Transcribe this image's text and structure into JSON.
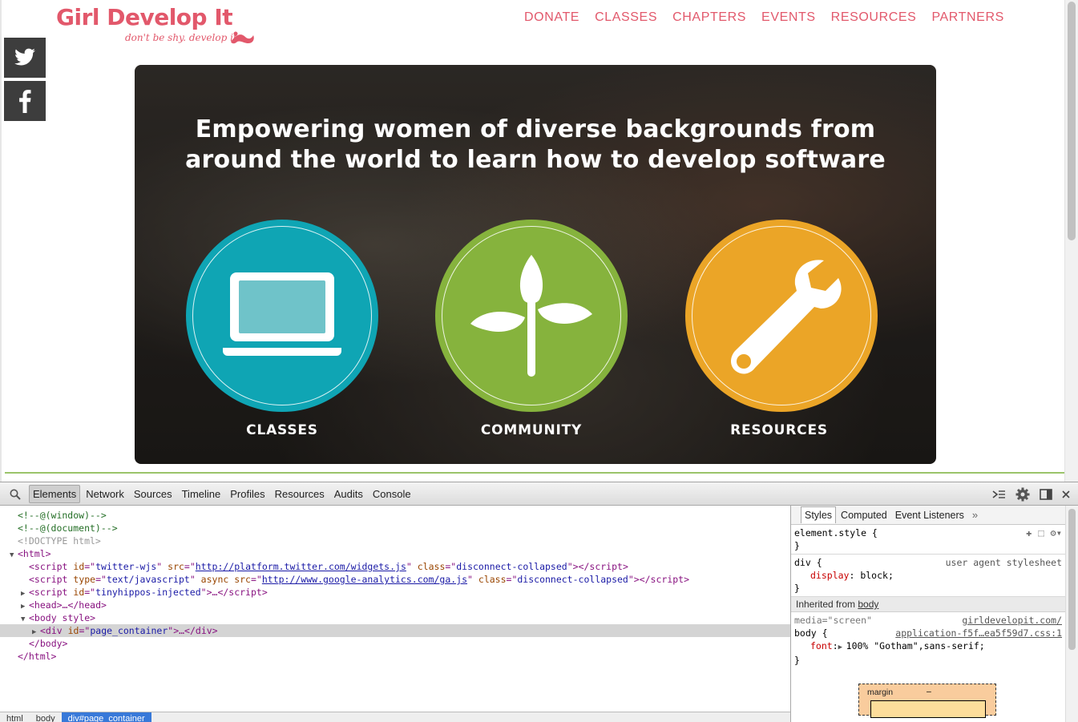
{
  "site": {
    "logo_title": "Girl Develop It",
    "logo_tagline": "don't be shy. develop it.",
    "nav": [
      "DONATE",
      "CLASSES",
      "CHAPTERS",
      "EVENTS",
      "RESOURCES",
      "PARTNERS"
    ],
    "social": [
      "twitter-icon",
      "facebook-icon"
    ],
    "hero_title_line1": "Empowering women of diverse backgrounds from",
    "hero_title_line2": "around the world to learn how to develop software",
    "circles": [
      {
        "label": "CLASSES",
        "color": "#0fa5b4",
        "icon": "laptop-icon"
      },
      {
        "label": "COMMUNITY",
        "color": "#86b33d",
        "icon": "sprout-icon"
      },
      {
        "label": "RESOURCES",
        "color": "#eba527",
        "icon": "wrench-icon"
      }
    ],
    "accent_color": "#e2586b"
  },
  "devtools": {
    "tabs": [
      "Elements",
      "Network",
      "Sources",
      "Timeline",
      "Profiles",
      "Resources",
      "Audits",
      "Console"
    ],
    "active_tab": "Elements",
    "dom": {
      "l1": "<!--@(window)-->",
      "l2": "<!--@(document)-->",
      "l3": "<!DOCTYPE html>",
      "html_open": "<html>",
      "s1_id": "twitter-wjs",
      "s1_src": "http://platform.twitter.com/widgets.js",
      "s1_class": "disconnect-collapsed",
      "s2_type": "text/javascript",
      "s2_src": "http://www.google-analytics.com/ga.js",
      "s2_class": "disconnect-collapsed",
      "s3_id": "tinyhippos-injected",
      "head": "<head>…</head>",
      "body_open": "<body style>",
      "div_id": "page_container",
      "body_close": "</body>",
      "html_close": "</html>"
    },
    "breadcrumbs": [
      "html",
      "body",
      "div#page_container"
    ],
    "styles": {
      "tabs": [
        "Styles",
        "Computed",
        "Event Listeners"
      ],
      "element_style": "element.style {",
      "rule2_selector": "div {",
      "rule2_source": "user agent stylesheet",
      "rule2_prop": "display",
      "rule2_val": "block;",
      "inherited_label": "Inherited from ",
      "inherited_from": "body",
      "media": "media=\"screen\"",
      "media_source": "girldevelopit.com/",
      "rule3_selector": "body {",
      "rule3_source": "application-f5f…ea5f59d7.css:1",
      "rule3_prop": "font",
      "rule3_val": "100% \"Gotham\",sans-serif;",
      "close_brace": "}",
      "boxmodel_label": "margin",
      "boxmodel_value": "–"
    }
  }
}
